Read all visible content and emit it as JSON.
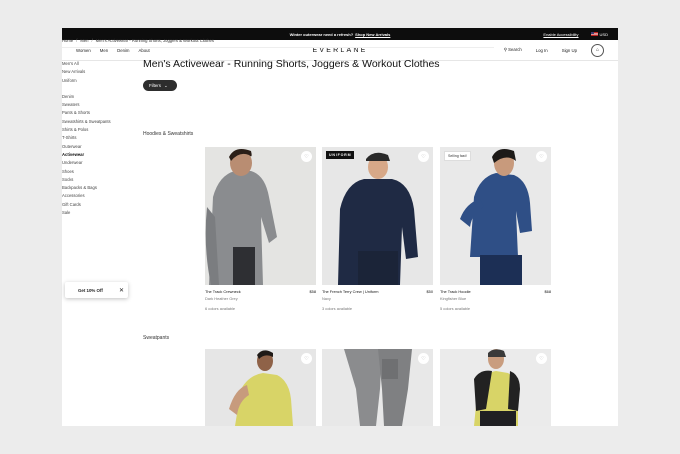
{
  "promo": {
    "text": "Winter outerwear need a refresh?",
    "link": "Shop New Arrivals",
    "accessibility": "Enable Accessibility",
    "currency": "USD"
  },
  "nav": {
    "items": [
      "Women",
      "Men",
      "Denim",
      "About"
    ],
    "logo": "EVERLANE",
    "search": "Search",
    "login": "Log In",
    "signup": "Sign Up"
  },
  "breadcrumb": {
    "home": "Home",
    "men": "Men",
    "current": "Men's Activewear - Running Shorts, Joggers & Workout Clothes"
  },
  "sidebar": {
    "group1": [
      "Men's All",
      "New Arrivals",
      "Uniform"
    ],
    "group2": [
      "Denim",
      "Sweaters",
      "Pants & Shorts",
      "Sweatshirts & Sweatpants",
      "Shirts & Polos",
      "T-Shirts",
      "Outerwear",
      "Activewear",
      "Underwear",
      "Shoes",
      "Socks",
      "Backpacks & Bags",
      "Accessories",
      "Gift Cards",
      "Sale"
    ],
    "active": "Activewear"
  },
  "page_title": "Men's Activewear - Running Shorts, Joggers & Workout Clothes",
  "filters_label": "Filters",
  "sections": [
    {
      "title": "Hoodies & Sweatshirts",
      "products": [
        {
          "name": "The Track Crewneck",
          "price": "$58",
          "color": "Dark Heather Grey",
          "availability": "6 colors available",
          "tag": ""
        },
        {
          "name": "The French Terry Crew | Uniform",
          "price": "$50",
          "color": "Navy",
          "availability": "3 colors available",
          "tag": "UNIFORM"
        },
        {
          "name": "The Track Hoodie",
          "price": "$68",
          "color": "Kingfisher Blue",
          "availability": "5 colors available",
          "tag": "Selling fast!"
        }
      ]
    },
    {
      "title": "Sweatpants",
      "products": [
        {},
        {},
        {}
      ]
    }
  ],
  "toast": {
    "label": "Get 10% Off",
    "close": "✕"
  },
  "colors": {
    "garment_grey": "#8a8c8f",
    "garment_navy": "#1f2a44",
    "garment_blue": "#2f4f86",
    "garment_yellow": "#d8d467"
  }
}
